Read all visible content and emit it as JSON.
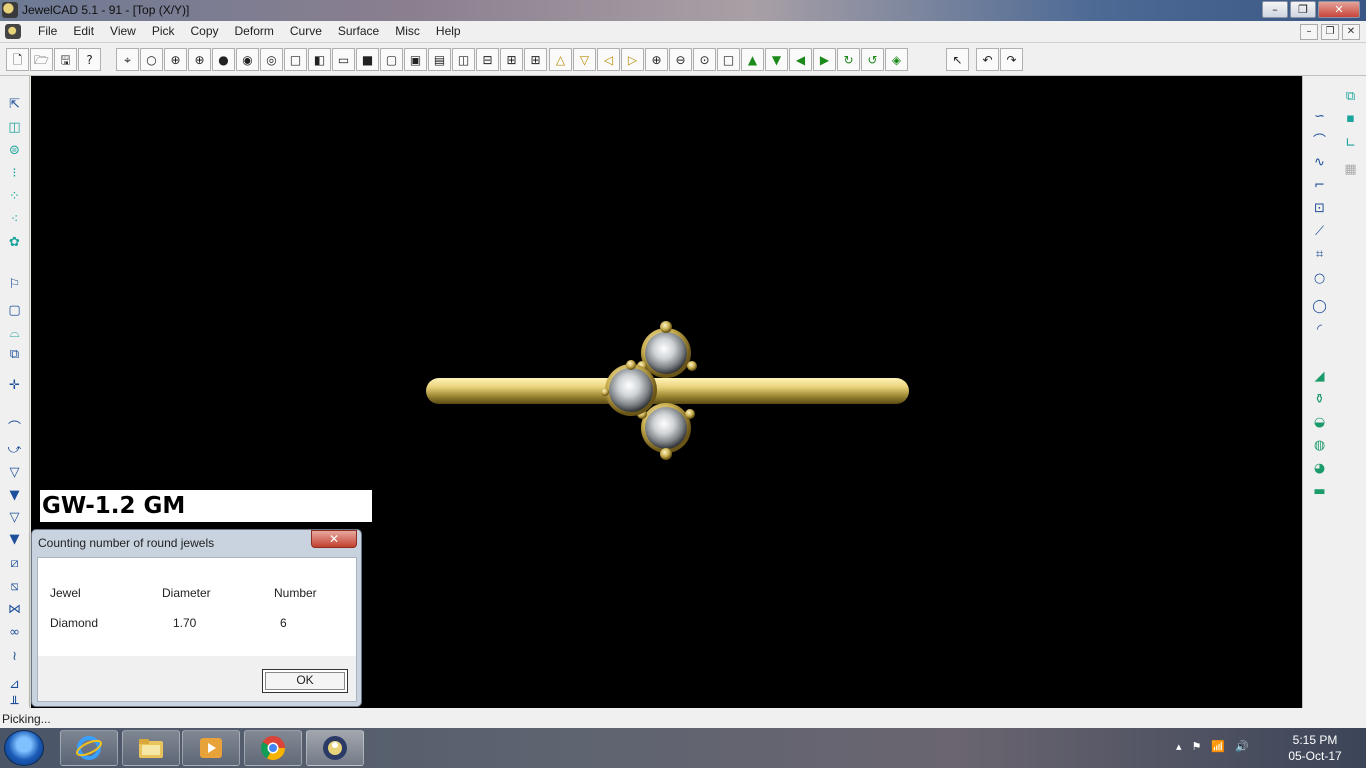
{
  "window": {
    "title": "JewelCAD 5.1 - 91 - [Top (X/Y)]",
    "minimize": "–",
    "restore": "❐",
    "close": "✕"
  },
  "menu": [
    "File",
    "Edit",
    "View",
    "Pick",
    "Copy",
    "Deform",
    "Curve",
    "Surface",
    "Misc",
    "Help"
  ],
  "mdi": {
    "minimize": "–",
    "restore": "❐",
    "close": "✕"
  },
  "toolbar": {
    "file_group": [
      "🗋",
      "🗁",
      "🖫",
      "?"
    ],
    "view_group": [
      "⌖",
      "○",
      "⊕",
      "⊕",
      "●",
      "◉",
      "◎",
      "□",
      "◧",
      "▭",
      "■",
      "▢",
      "▣",
      "▤",
      "◫",
      "⊟",
      "⊞",
      "⊞"
    ],
    "nav_group": [
      "△",
      "▽",
      "◁",
      "▷",
      "⊕",
      "⊖",
      "⊙",
      "□",
      "▲",
      "▼",
      "◀",
      "▶",
      "↻",
      "↺",
      "◈"
    ],
    "edit_group": [
      "↖",
      "↶",
      "↷"
    ]
  },
  "overlay": {
    "gw_text": "GW-1.2 GM"
  },
  "dialog": {
    "title": "Counting number of round jewels",
    "close": "✕",
    "headers": {
      "jewel": "Jewel",
      "diameter": "Diameter",
      "number": "Number"
    },
    "row": {
      "jewel": "Diamond",
      "diameter": "1.70",
      "number": "6"
    },
    "ok_label": "OK"
  },
  "status": {
    "text": "Picking..."
  },
  "taskbar": {
    "time": "5:15 PM",
    "date": "05-Oct-17",
    "tray_icons": [
      "▴",
      "⚑",
      "📶",
      "🔊"
    ]
  },
  "colors": {
    "viewport": "#000000",
    "gold": "#e8d27a",
    "dialog_frame": "#c9d3e0"
  }
}
